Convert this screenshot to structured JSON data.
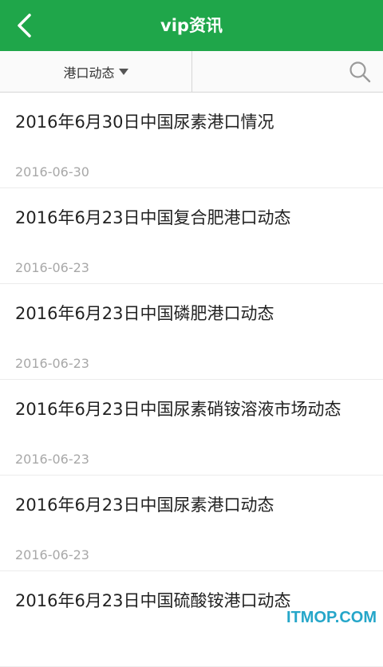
{
  "header": {
    "title": "vip资讯",
    "back_icon": "chevron-left-icon",
    "color": "#1fa64a"
  },
  "filter": {
    "selected": "港口动态",
    "search_icon": "search-icon"
  },
  "news": [
    {
      "title": "2016年6月30日中国尿素港口情况",
      "date": "2016-06-30"
    },
    {
      "title": "2016年6月23日中国复合肥港口动态",
      "date": "2016-06-23"
    },
    {
      "title": "2016年6月23日中国磷肥港口动态",
      "date": "2016-06-23"
    },
    {
      "title": "2016年6月23日中国尿素硝铵溶液市场动态",
      "date": "2016-06-23"
    },
    {
      "title": "2016年6月23日中国尿素港口动态",
      "date": "2016-06-23"
    },
    {
      "title": "2016年6月23日中国硫酸铵港口动态",
      "date": ""
    }
  ],
  "watermark": "ITMOP.COM"
}
